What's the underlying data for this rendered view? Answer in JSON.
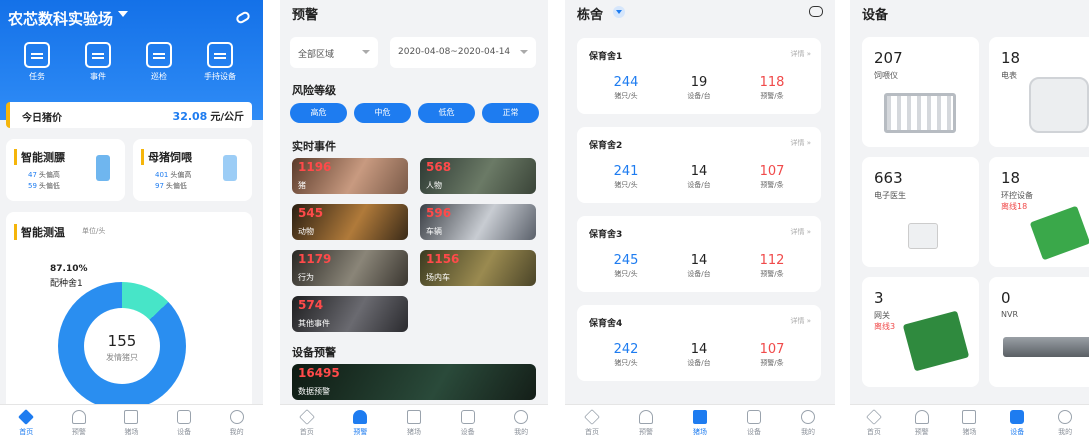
{
  "p1": {
    "title": "农芯数科实验场",
    "actions": [
      {
        "label": "任务"
      },
      {
        "label": "事件"
      },
      {
        "label": "巡检"
      },
      {
        "label": "手持设备"
      }
    ],
    "price": {
      "label": "今日猪价",
      "value": "32.08",
      "unit": "元/公斤"
    },
    "card_a": {
      "title": "智能测膘",
      "row1_num": "47",
      "row1_txt": "头偏高",
      "row2_num": "59",
      "row2_txt": "头偏低"
    },
    "card_b": {
      "title": "母猪饲喂",
      "row1_num": "401",
      "row1_txt": "头偏高",
      "row2_num": "97",
      "row2_txt": "头偏低"
    },
    "temp": {
      "title": "智能测温",
      "unit": "单位/头",
      "pct": "87.10%",
      "pct_label": "配种舍1",
      "center_value": "155",
      "center_label": "发情猪只"
    }
  },
  "p2": {
    "title": "预警",
    "region": "全部区域",
    "date_range": "2020-04-08~2020-04-14",
    "risk_title": "风险等级",
    "risk": [
      "高危",
      "中危",
      "低危",
      "正常"
    ],
    "events_title": "实时事件",
    "events": [
      {
        "n": "1196",
        "l": "猪"
      },
      {
        "n": "568",
        "l": "人物"
      },
      {
        "n": "545",
        "l": "动物"
      },
      {
        "n": "596",
        "l": "车辆"
      },
      {
        "n": "1179",
        "l": "行为"
      },
      {
        "n": "1156",
        "l": "场内车"
      },
      {
        "n": "574",
        "l": "其他事件"
      }
    ],
    "device_title": "设备预警",
    "device_event": {
      "n": "16495",
      "l": "数据预警"
    }
  },
  "p3": {
    "title": "栋舍",
    "detail": "详情 »",
    "houses": [
      {
        "name": "保育舍1",
        "pigs": "244",
        "devices": "19",
        "alerts": "118"
      },
      {
        "name": "保育舍2",
        "pigs": "241",
        "devices": "14",
        "alerts": "107"
      },
      {
        "name": "保育舍3",
        "pigs": "245",
        "devices": "14",
        "alerts": "112"
      },
      {
        "name": "保育舍4",
        "pigs": "242",
        "devices": "14",
        "alerts": "107"
      }
    ],
    "labels": {
      "pigs": "猪只/头",
      "devices": "设备/台",
      "alerts": "预警/条"
    }
  },
  "p4": {
    "title": "设备",
    "devices": [
      {
        "n": "207",
        "l": "饲喂仪",
        "off": ""
      },
      {
        "n": "18",
        "l": "电表",
        "off": ""
      },
      {
        "n": "663",
        "l": "电子医生",
        "off": ""
      },
      {
        "n": "18",
        "l": "环控设备",
        "off": "离线18"
      },
      {
        "n": "3",
        "l": "网关",
        "off": "离线3"
      },
      {
        "n": "0",
        "l": "NVR",
        "off": ""
      }
    ]
  },
  "tabs": {
    "home": "首页",
    "warn": "预警",
    "farm": "猪场",
    "device": "设备",
    "mine": "我的"
  },
  "colors": {
    "accent": "#1e7cf0",
    "alert": "#f04a4a",
    "highlight": "#f5b50a"
  }
}
